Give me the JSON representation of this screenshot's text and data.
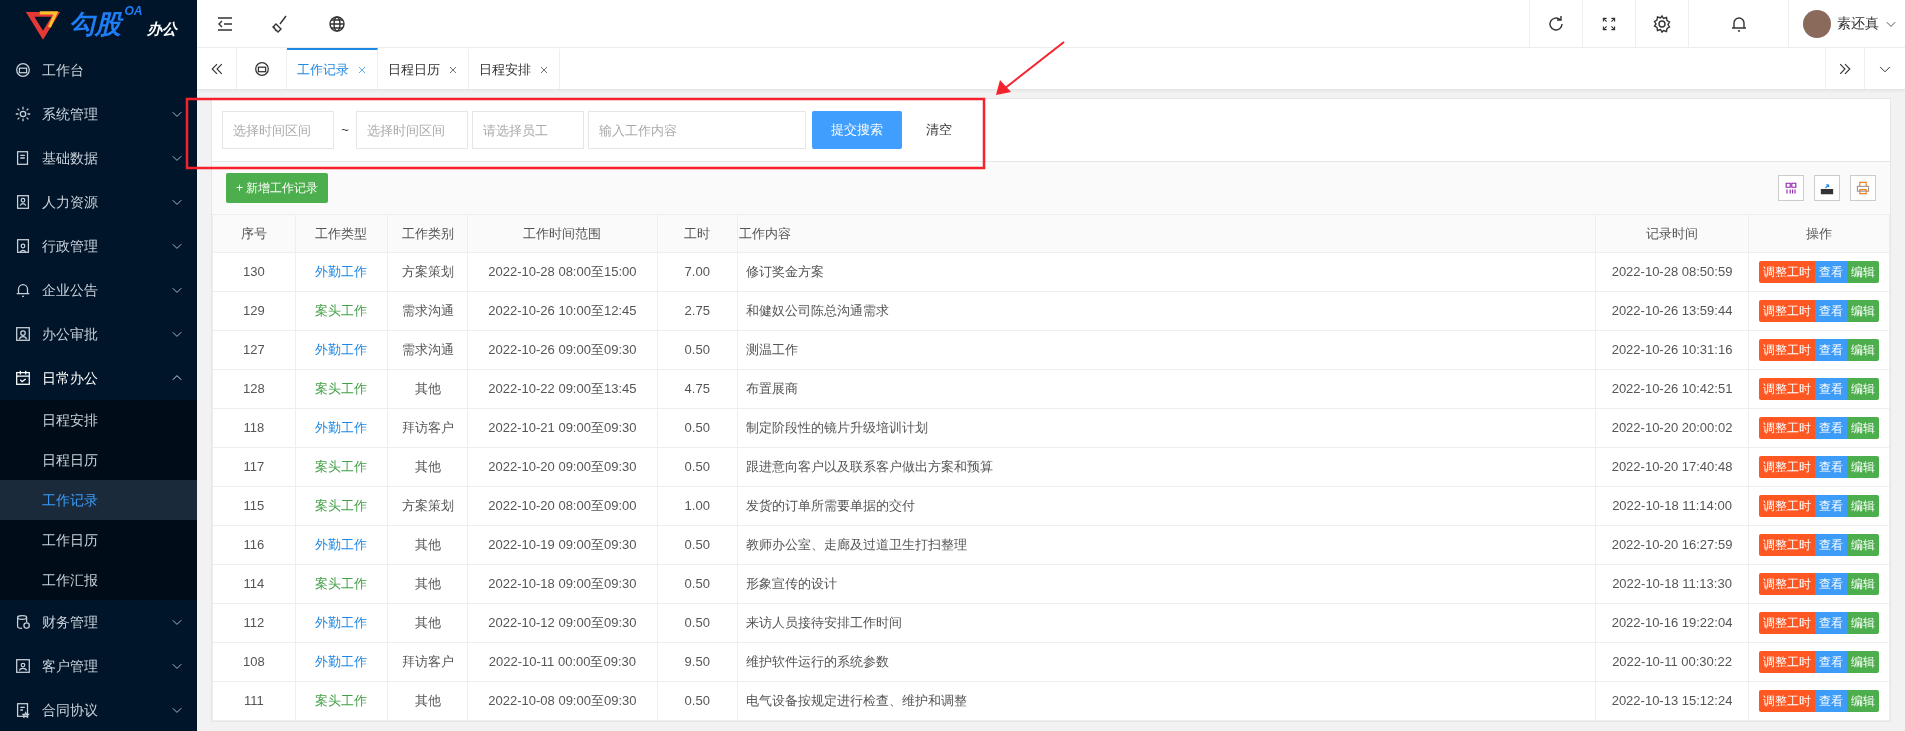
{
  "sidebar": {
    "logo": {
      "badge": "OA",
      "brand": "勾股",
      "suffix": "办公"
    },
    "items": [
      {
        "label": "工作台"
      },
      {
        "label": "系统管理",
        "expanded": false
      },
      {
        "label": "基础数据",
        "expanded": false
      },
      {
        "label": "人力资源",
        "expanded": false
      },
      {
        "label": "行政管理",
        "expanded": false
      },
      {
        "label": "企业公告",
        "expanded": false
      },
      {
        "label": "办公审批",
        "expanded": false
      },
      {
        "label": "日常办公",
        "expanded": true,
        "children": [
          {
            "label": "日程安排",
            "selected": false
          },
          {
            "label": "日程日历",
            "selected": false
          },
          {
            "label": "工作记录",
            "selected": true
          },
          {
            "label": "工作日历",
            "selected": false
          },
          {
            "label": "工作汇报",
            "selected": false
          }
        ]
      },
      {
        "label": "财务管理",
        "expanded": false
      },
      {
        "label": "客户管理",
        "expanded": false
      },
      {
        "label": "合同协议",
        "expanded": false
      }
    ]
  },
  "header": {
    "user": "素还真"
  },
  "tabs": [
    {
      "label": "工作记录",
      "selected": true
    },
    {
      "label": "日程日历",
      "selected": false
    },
    {
      "label": "日程安排",
      "selected": false
    }
  ],
  "search": {
    "fields": [
      {
        "placeholder": "选择时间区间"
      },
      {
        "placeholder": "选择时间区间"
      },
      {
        "placeholder": "请选择员工"
      },
      {
        "placeholder": "输入工作内容"
      }
    ],
    "separator": "~",
    "submit": "提交搜索",
    "clear": "清空"
  },
  "toolbar": {
    "add_button": "+ 新增工作记录"
  },
  "table": {
    "columns": [
      "序号",
      "工作类型",
      "工作类别",
      "工作时间范围",
      "工时",
      "工作内容",
      "记录时间",
      "操作"
    ],
    "rows": [
      {
        "id": "130",
        "type": {
          "text": "外勤工作",
          "color": "#1e88e5"
        },
        "category": "方案策划",
        "time_range": "2022-10-28 08:00至15:00",
        "hours": "7.00",
        "content": "修订奖金方案",
        "recorded_at": "2022-10-28 08:50:59",
        "actions": [
          {
            "label": "调整工时",
            "color": "#ff5722"
          },
          {
            "label": "查看",
            "color": "#3c9cf7"
          },
          {
            "label": "编辑",
            "color": "#4cae4c"
          }
        ]
      },
      {
        "id": "129",
        "type": {
          "text": "案头工作",
          "color": "#43a047"
        },
        "category": "需求沟通",
        "time_range": "2022-10-26 10:00至12:45",
        "hours": "2.75",
        "content": "和健奴公司陈总沟通需求",
        "recorded_at": "2022-10-26 13:59:44",
        "actions": [
          {
            "label": "调整工时",
            "color": "#ff5722"
          },
          {
            "label": "查看",
            "color": "#3c9cf7"
          },
          {
            "label": "编辑",
            "color": "#4cae4c"
          }
        ]
      },
      {
        "id": "127",
        "type": {
          "text": "外勤工作",
          "color": "#1e88e5"
        },
        "category": "需求沟通",
        "time_range": "2022-10-26 09:00至09:30",
        "hours": "0.50",
        "content": "测温工作",
        "recorded_at": "2022-10-26 10:31:16",
        "actions": [
          {
            "label": "调整工时",
            "color": "#ff5722"
          },
          {
            "label": "查看",
            "color": "#3c9cf7"
          },
          {
            "label": "编辑",
            "color": "#4cae4c"
          }
        ]
      },
      {
        "id": "128",
        "type": {
          "text": "案头工作",
          "color": "#43a047"
        },
        "category": "其他",
        "time_range": "2022-10-22 09:00至13:45",
        "hours": "4.75",
        "content": "布置展商",
        "recorded_at": "2022-10-26 10:42:51",
        "actions": [
          {
            "label": "调整工时",
            "color": "#ff5722"
          },
          {
            "label": "查看",
            "color": "#3c9cf7"
          },
          {
            "label": "编辑",
            "color": "#4cae4c"
          }
        ]
      },
      {
        "id": "118",
        "type": {
          "text": "外勤工作",
          "color": "#1e88e5"
        },
        "category": "拜访客户",
        "time_range": "2022-10-21 09:00至09:30",
        "hours": "0.50",
        "content": "制定阶段性的镜片升级培训计划",
        "recorded_at": "2022-10-20 20:00:02",
        "actions": [
          {
            "label": "调整工时",
            "color": "#ff5722"
          },
          {
            "label": "查看",
            "color": "#3c9cf7"
          },
          {
            "label": "编辑",
            "color": "#4cae4c"
          }
        ]
      },
      {
        "id": "117",
        "type": {
          "text": "案头工作",
          "color": "#43a047"
        },
        "category": "其他",
        "time_range": "2022-10-20 09:00至09:30",
        "hours": "0.50",
        "content": "跟进意向客户以及联系客户做出方案和预算",
        "recorded_at": "2022-10-20 17:40:48",
        "actions": [
          {
            "label": "调整工时",
            "color": "#ff5722"
          },
          {
            "label": "查看",
            "color": "#3c9cf7"
          },
          {
            "label": "编辑",
            "color": "#4cae4c"
          }
        ]
      },
      {
        "id": "115",
        "type": {
          "text": "案头工作",
          "color": "#43a047"
        },
        "category": "方案策划",
        "time_range": "2022-10-20 08:00至09:00",
        "hours": "1.00",
        "content": "发货的订单所需要单据的交付",
        "recorded_at": "2022-10-18 11:14:00",
        "actions": [
          {
            "label": "调整工时",
            "color": "#ff5722"
          },
          {
            "label": "查看",
            "color": "#3c9cf7"
          },
          {
            "label": "编辑",
            "color": "#4cae4c"
          }
        ]
      },
      {
        "id": "116",
        "type": {
          "text": "外勤工作",
          "color": "#1e88e5"
        },
        "category": "其他",
        "time_range": "2022-10-19 09:00至09:30",
        "hours": "0.50",
        "content": "教师办公室、走廊及过道卫生打扫整理",
        "recorded_at": "2022-10-20 16:27:59",
        "actions": [
          {
            "label": "调整工时",
            "color": "#ff5722"
          },
          {
            "label": "查看",
            "color": "#3c9cf7"
          },
          {
            "label": "编辑",
            "color": "#4cae4c"
          }
        ]
      },
      {
        "id": "114",
        "type": {
          "text": "案头工作",
          "color": "#43a047"
        },
        "category": "其他",
        "time_range": "2022-10-18 09:00至09:30",
        "hours": "0.50",
        "content": "形象宣传的设计",
        "recorded_at": "2022-10-18 11:13:30",
        "actions": [
          {
            "label": "调整工时",
            "color": "#ff5722"
          },
          {
            "label": "查看",
            "color": "#3c9cf7"
          },
          {
            "label": "编辑",
            "color": "#4cae4c"
          }
        ]
      },
      {
        "id": "112",
        "type": {
          "text": "外勤工作",
          "color": "#1e88e5"
        },
        "category": "其他",
        "time_range": "2022-10-12 09:00至09:30",
        "hours": "0.50",
        "content": "来访人员接待安排工作时间",
        "recorded_at": "2022-10-16 19:22:04",
        "actions": [
          {
            "label": "调整工时",
            "color": "#ff5722"
          },
          {
            "label": "查看",
            "color": "#3c9cf7"
          },
          {
            "label": "编辑",
            "color": "#4cae4c"
          }
        ]
      },
      {
        "id": "108",
        "type": {
          "text": "外勤工作",
          "color": "#1e88e5"
        },
        "category": "拜访客户",
        "time_range": "2022-10-11 00:00至09:30",
        "hours": "9.50",
        "content": "维护软件运行的系统参数",
        "recorded_at": "2022-10-11 00:30:22",
        "actions": [
          {
            "label": "调整工时",
            "color": "#ff5722"
          },
          {
            "label": "查看",
            "color": "#3c9cf7"
          },
          {
            "label": "编辑",
            "color": "#4cae4c"
          }
        ]
      },
      {
        "id": "111",
        "type": {
          "text": "案头工作",
          "color": "#43a047"
        },
        "category": "其他",
        "time_range": "2022-10-08 09:00至09:30",
        "hours": "0.50",
        "content": "电气设备按规定进行检查、维护和调整",
        "recorded_at": "2022-10-13 15:12:24",
        "actions": [
          {
            "label": "调整工时",
            "color": "#ff5722"
          },
          {
            "label": "查看",
            "color": "#3c9cf7"
          },
          {
            "label": "编辑",
            "color": "#4cae4c"
          }
        ]
      }
    ]
  }
}
